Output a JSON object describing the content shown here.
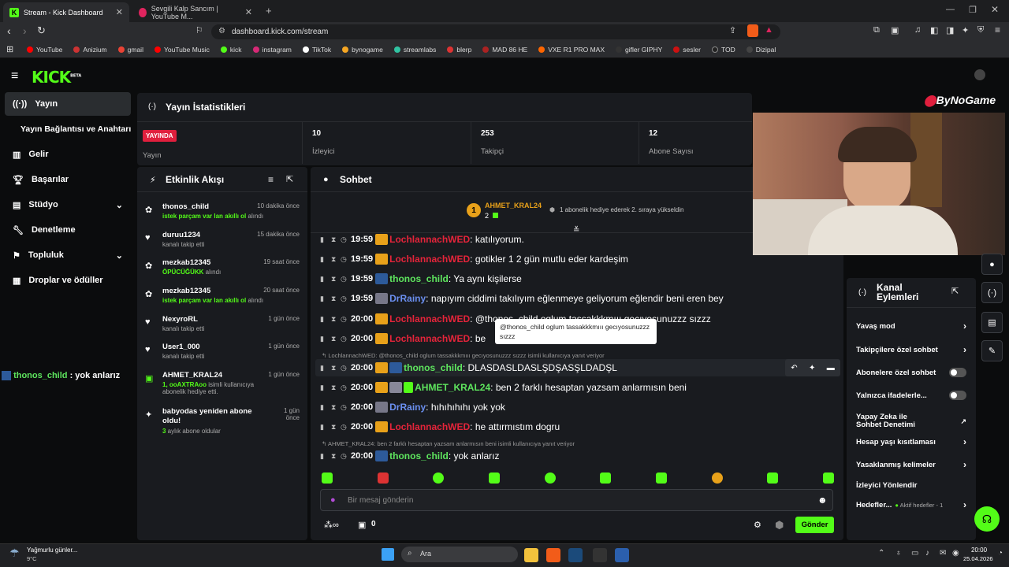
{
  "browser": {
    "tabs": [
      {
        "title": "Stream - Kick Dashboard"
      },
      {
        "title": "Sevgili Kalp Sancım | YouTube M..."
      }
    ],
    "url": "dashboard.kick.com/stream",
    "bookmarks": [
      "YouTube",
      "Anizium",
      "gmail",
      "YouTube Music",
      "kick",
      "instagram",
      "TikTok",
      "bynogame",
      "streamlabs",
      "blerp",
      "MAD 86 HE",
      "VXE R1 PRO MAX",
      "gifler GIPHY",
      "sesler",
      "TOD",
      "Dizipal"
    ]
  },
  "brand": {
    "logo": "KICK",
    "beta": "BETA",
    "color": "#53fc18"
  },
  "sidebar": {
    "items": [
      {
        "label": "Yayın"
      },
      {
        "label": "Yayın Bağlantısı ve Anahtarı"
      },
      {
        "label": "Gelir"
      },
      {
        "label": "Başarılar"
      },
      {
        "label": "Stüdyo"
      },
      {
        "label": "Denetleme"
      },
      {
        "label": "Topluluk"
      },
      {
        "label": "Droplar ve ödüller"
      }
    ]
  },
  "stats": {
    "title": "Yayın İstatistikleri",
    "live_badge": "YAYINDA",
    "live_label": "Yayın",
    "viewers": {
      "value": "10",
      "label": "İzleyici"
    },
    "followers": {
      "value": "253",
      "label": "Takipçi"
    },
    "subs": {
      "value": "12",
      "label": "Abone Sayısı"
    }
  },
  "activity": {
    "title": "Etkinlik Akışı",
    "items": [
      {
        "name": "thonos_child",
        "time": "10 dakika önce",
        "desc_hl": "istek parçam var lan akıllı ol",
        "desc": " alındı"
      },
      {
        "name": "duruu1234",
        "time": "15 dakika önce",
        "desc_hl": "",
        "desc": "kanalı takip etti"
      },
      {
        "name": "mezkab12345",
        "time": "19 saat önce",
        "desc_hl": "ÖPÜCÜĞÜKK",
        "desc": " alındı"
      },
      {
        "name": "mezkab12345",
        "time": "20 saat önce",
        "desc_hl": "istek parçam var lan akıllı ol",
        "desc": " alındı"
      },
      {
        "name": "NexyroRL",
        "time": "1 gün önce",
        "desc_hl": "",
        "desc": "kanalı takip etti"
      },
      {
        "name": "User1_000",
        "time": "1 gün önce",
        "desc_hl": "",
        "desc": "kanalı takip etti"
      },
      {
        "name": "AHMET_KRAL24",
        "time": "1 gün önce",
        "desc_hl": "1, ooAXTRAoo",
        "desc": " isimli kullanıcıya abonelik hediye etti."
      },
      {
        "name": "babyodas yeniden abone oldu!",
        "time": "1 gün önce",
        "desc_hl": "3",
        "desc": " aylık abone oldular"
      }
    ]
  },
  "chat": {
    "title": "Sohbet",
    "gifter": {
      "name": "AHMET_KRAL24",
      "count": "2",
      "rank": "1",
      "note": "1 abonelik hediye ederek 2. sıraya yükseldin"
    },
    "messages": [
      {
        "time": "19:59",
        "user": "LochlannachWED",
        "text": ": katılıyorum."
      },
      {
        "time": "19:59",
        "user": "LochlannachWED",
        "text": ": gotikler 1 2 gün mutlu eder kardeşim"
      },
      {
        "time": "19:59",
        "user": "thonos_child",
        "text": ": Ya aynı kişilerse"
      },
      {
        "time": "19:59",
        "user": "DrRainy",
        "text": ": napıyım ciddimi takılıyım eğlenmeye geliyorum eğlendir beni eren bey"
      },
      {
        "time": "20:00",
        "user": "LochlannachWED",
        "text": ": @thonos_child oglum tassakkkmııı gecıyosunuzzz sızzz"
      },
      {
        "time": "20:00",
        "user": "LochlannachWED",
        "text": ": be"
      },
      {
        "time": "20:00",
        "user": "thonos_child",
        "text": ": DLASDASLDASLŞDŞASŞLDADŞL"
      },
      {
        "time": "20:00",
        "user": "AHMET_KRAL24",
        "text": ": ben 2 farklı hesaptan yazsam anlarmısın beni"
      },
      {
        "time": "20:00",
        "user": "DrRainy",
        "text": ": hıhıhıhıhı yok yok"
      },
      {
        "time": "20:00",
        "user": "LochlannachWED",
        "text": ": he attırmıstım dogru"
      },
      {
        "time": "20:00",
        "user": "thonos_child",
        "text": ": yok anlarız"
      }
    ],
    "reply1": "LochlannachWED: @thonos_child oglum tassakkkmııı gecıyosunuzzz sızzz isimli kullanıcıya yanıt veriyor",
    "reply2": "AHMET_KRAL24: ben 2 farklı hesaptan yazsam anlarmısın beni isimli kullanıcıya yanıt veriyor",
    "tooltip": "@thonos_child oglum tassakkkmııı gecıyosunuzzz sızzz",
    "placeholder": "Bir mesaj gönderin",
    "points": "0",
    "send": "Gönder"
  },
  "overlay_chat": {
    "user": "thonos_child",
    "text": " : yok anlarız"
  },
  "watermark": "ByNoGame",
  "channel_actions": {
    "title": "Kanal Eylemleri",
    "items": [
      {
        "label": "Yavaş mod",
        "type": "arrow"
      },
      {
        "label": "Takipçilere özel sohbet",
        "type": "arrow"
      },
      {
        "label": "Abonelere özel sohbet",
        "type": "toggle"
      },
      {
        "label": "Yalnızca ifadelerle...",
        "type": "toggle"
      },
      {
        "label": "Yapay Zeka ile Sohbet Denetimi",
        "type": "ext"
      },
      {
        "label": "Hesap yaşı kısıtlaması",
        "type": "arrow"
      },
      {
        "label": "Yasaklanmış kelimeler",
        "type": "arrow"
      },
      {
        "label": "İzleyici Yönlendir",
        "type": "none"
      },
      {
        "label": "Hedefler...",
        "type": "arrow"
      }
    ],
    "goals_note": "Aktif hedefler - 1"
  },
  "taskbar": {
    "weather": "Yağmurlu günler...",
    "temp": "9°C",
    "search": "Ara",
    "time": "20:00",
    "date": "25.04.2026"
  }
}
